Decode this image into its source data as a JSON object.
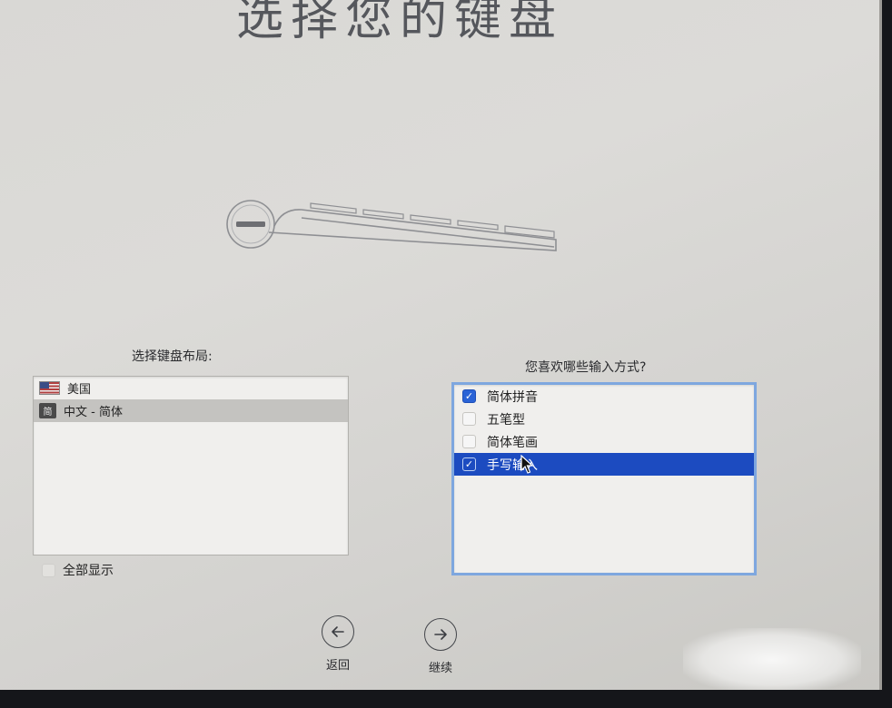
{
  "header": {
    "title": "选择您的键盘"
  },
  "layout_section": {
    "label": "选择键盘布局:",
    "items": [
      {
        "label": "美国",
        "icon": "us-flag-icon",
        "selected": false
      },
      {
        "label": "中文 - 简体",
        "icon": "chinese-input-icon",
        "icon_glyph": "简",
        "selected": true
      }
    ],
    "show_all": {
      "label": "全部显示",
      "checked": false
    }
  },
  "method_section": {
    "label": "您喜欢哪些输入方式?",
    "items": [
      {
        "label": "简体拼音",
        "checked": true,
        "selected": false
      },
      {
        "label": "五笔型",
        "checked": false,
        "selected": false
      },
      {
        "label": "简体笔画",
        "checked": false,
        "selected": false
      },
      {
        "label": "手写输入",
        "checked": true,
        "selected": true
      }
    ]
  },
  "navigation": {
    "back": {
      "label": "返回",
      "icon": "arrow-left-icon"
    },
    "continue": {
      "label": "继续",
      "icon": "arrow-right-icon"
    }
  },
  "colors": {
    "selection": "#1c4bc0",
    "focus_ring": "#7ea7df",
    "checkbox_checked": "#2a63d6",
    "layout_selected": "#c4c3c0"
  }
}
